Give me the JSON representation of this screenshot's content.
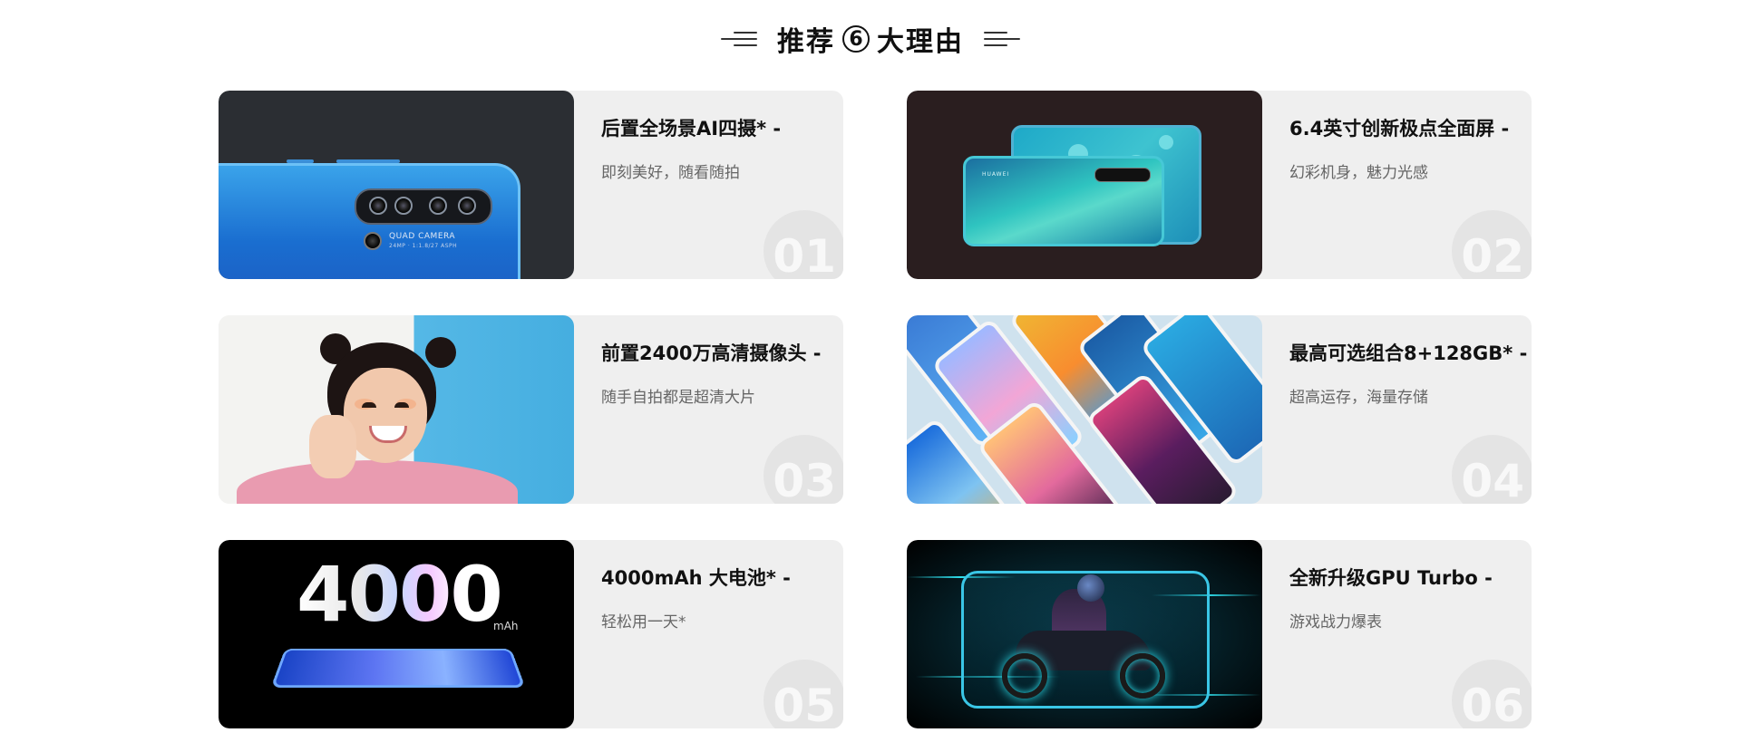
{
  "header": {
    "title_prefix": "推荐",
    "title_number": "6",
    "title_suffix": "大理由"
  },
  "reasons": [
    {
      "title": "后置全场景AI四摄* -",
      "desc": "即刻美好，随看随拍",
      "number": "01",
      "image": "quad-camera-phone-back",
      "camera_label": "QUAD CAMERA",
      "camera_sub": "24MP · 1:1.8/27 ASPH"
    },
    {
      "title": "6.4英寸创新极点全面屏  -",
      "desc": "幻彩机身，魅力光感",
      "number": "02",
      "image": "two-phones-front-back",
      "brand_label": "HUAWEI"
    },
    {
      "title": "前置2400万高清摄像头 -",
      "desc": "随手自拍都是超清大片",
      "number": "03",
      "image": "selfie-girl"
    },
    {
      "title": "最高可选组合8+128GB* -",
      "desc": "超高运存，海量存储",
      "number": "04",
      "image": "tilted-phone-screens"
    },
    {
      "title": "4000mAh 大电池* -",
      "desc": "轻松用一天*",
      "number": "05",
      "image": "battery-4000",
      "battery_value": "4000",
      "battery_unit": "mAh"
    },
    {
      "title": "全新升级GPU Turbo -",
      "desc": "游戏战力爆表",
      "number": "06",
      "image": "gpu-turbo-motorbike"
    }
  ],
  "colors": {
    "card_bg": "#efefef",
    "number_circle": "#e4e4e4",
    "title_text": "#111111",
    "desc_text": "#666666"
  }
}
